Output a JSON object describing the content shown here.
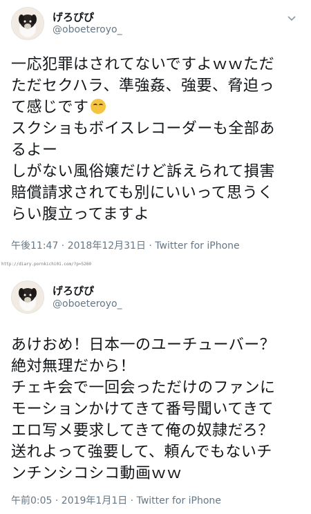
{
  "tweets": [
    {
      "name": "げろぴぴ",
      "handle": "@oboeteroyo_",
      "text_a": "一応犯罪はされてないですよｗｗただ\nただセクハラ、準強姦、強要、脅迫っ\nて感じです",
      "emoji": "blush-emoji",
      "text_b": "スクショもボイスレコーダーも全部あ\nるよー\nしがない風俗嬢だけど訴えられて損害\n賠償請求されても別にいいって思うく\nらい腹立ってますよ",
      "meta": "午後11:47 · 2018年12月31日 · Twitter for iPhone"
    },
    {
      "name": "げろぴぴ",
      "handle": "@oboeteroyo_",
      "text": "あけおめ！日本一のユーチューバー？\n絶対無理だから！\nチェキ会で一回会っただけのファンに\nモーションかけてきて番号聞いてきて\nエロ写メ要求してきて俺の奴隷だろ？\n送れよって強要して、頼んでもないチ\nンチンシコシコ動画ｗｗ",
      "meta": "午前0:05 · 2019年1月1日 · Twitter for iPhone"
    }
  ],
  "watermark": "http://diary.pornkichi01.com/?p=5260",
  "colors": {
    "text": "#14171a",
    "secondary": "#657786",
    "chevron": "#8899a6"
  }
}
